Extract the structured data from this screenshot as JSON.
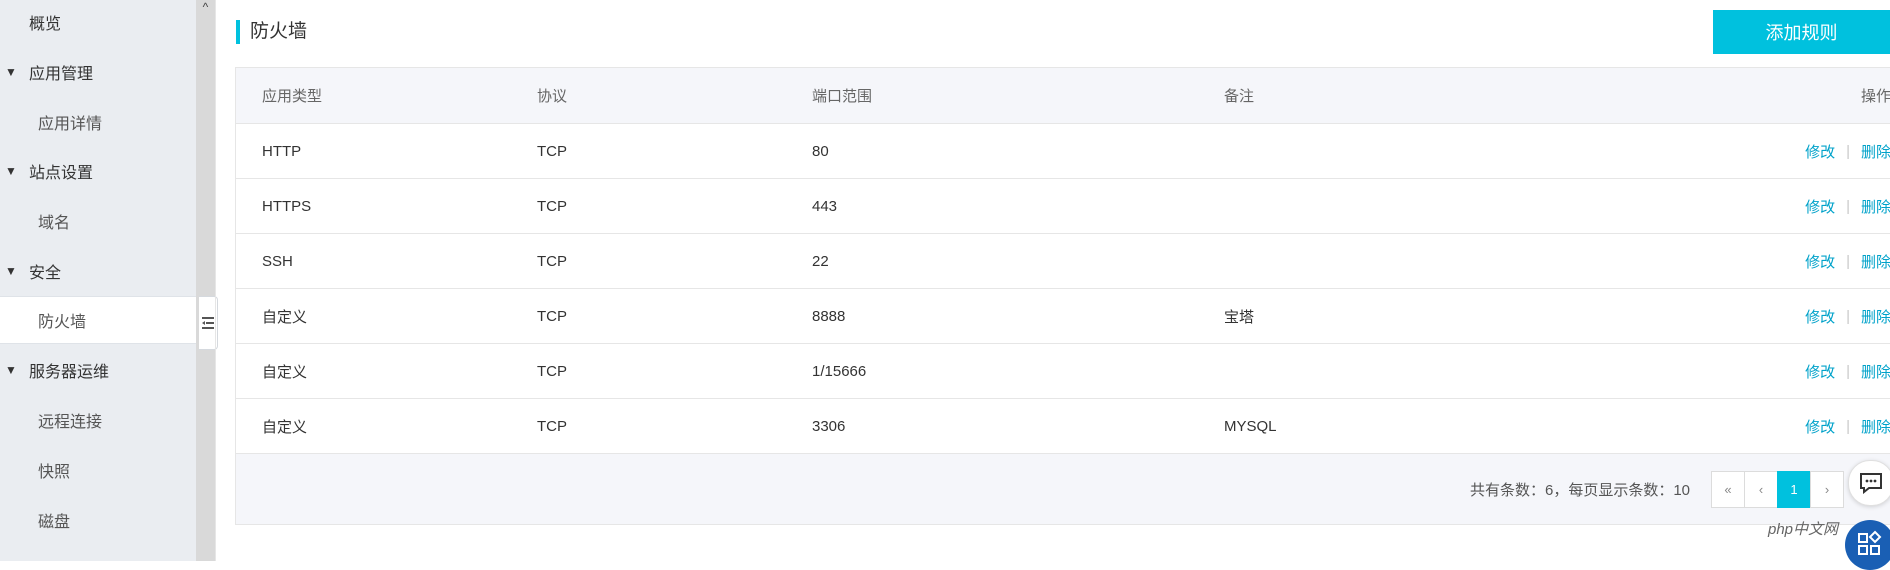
{
  "sidebar": {
    "overview": "概览",
    "app_mgmt": "应用管理",
    "app_detail": "应用详情",
    "site_settings": "站点设置",
    "domain": "域名",
    "security": "安全",
    "firewall": "防火墙",
    "server_ops": "服务器运维",
    "remote_connect": "远程连接",
    "snapshot": "快照",
    "disk": "磁盘"
  },
  "header": {
    "title": "防火墙",
    "add_rule_label": "添加规则"
  },
  "table": {
    "columns": [
      "应用类型",
      "协议",
      "端口范围",
      "备注",
      "操作"
    ],
    "rows": [
      {
        "type": "HTTP",
        "protocol": "TCP",
        "port": "80",
        "note": ""
      },
      {
        "type": "HTTPS",
        "protocol": "TCP",
        "port": "443",
        "note": ""
      },
      {
        "type": "SSH",
        "protocol": "TCP",
        "port": "22",
        "note": ""
      },
      {
        "type": "自定义",
        "protocol": "TCP",
        "port": "8888",
        "note": "宝塔"
      },
      {
        "type": "自定义",
        "protocol": "TCP",
        "port": "1/15666",
        "note": ""
      },
      {
        "type": "自定义",
        "protocol": "TCP",
        "port": "3306",
        "note": "MYSQL"
      }
    ],
    "edit_label": "修改",
    "delete_label": "删除",
    "separator": "|"
  },
  "pagination": {
    "info": "共有条数：6，每页显示条数：10",
    "first": "«",
    "prev": "‹",
    "current": "1",
    "next": "›"
  },
  "watermark": "php中文网",
  "colors": {
    "accent": "#00c1de",
    "link": "#00a2ca",
    "sidebar_bg": "#eaedf1",
    "header_row_bg": "#f5f6fa"
  }
}
